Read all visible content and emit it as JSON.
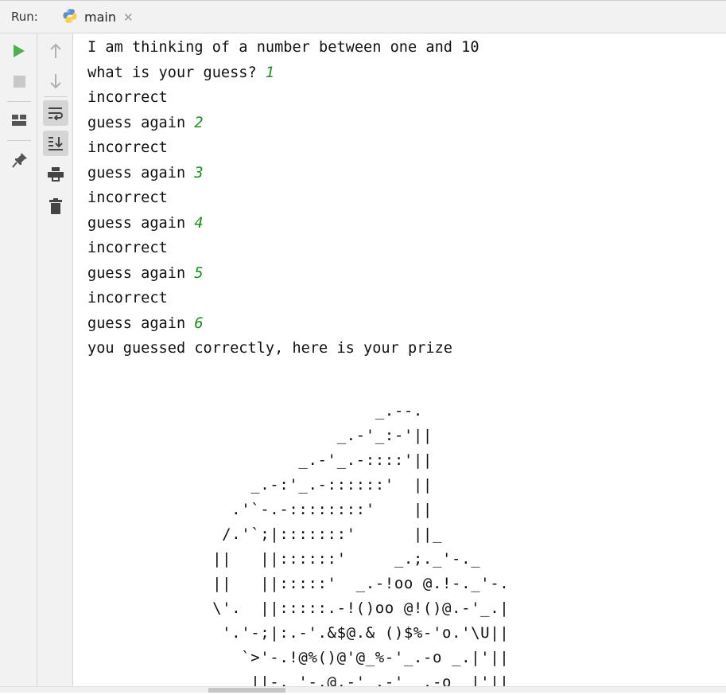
{
  "run_panel": {
    "label": "Run:",
    "tab": {
      "label": "main",
      "icon": "python-icon",
      "close_icon": "close-icon"
    }
  },
  "left_toolbar": [
    "rerun-icon",
    "stop-icon",
    "layout-icon",
    "pin-icon"
  ],
  "side_toolbar": [
    "up-arrow-icon",
    "down-arrow-icon",
    "soft-wrap-icon",
    "scroll-to-end-icon",
    "print-icon",
    "trash-icon"
  ],
  "colors": {
    "input_text": "#1f8a1f",
    "run_green": "#4caf50"
  },
  "console": {
    "lines": [
      {
        "text": "I am thinking of a number between one and 10",
        "input": ""
      },
      {
        "text": "what is your guess? ",
        "input": "1"
      },
      {
        "text": "incorrect",
        "input": ""
      },
      {
        "text": "guess again ",
        "input": "2"
      },
      {
        "text": "incorrect",
        "input": ""
      },
      {
        "text": "guess again ",
        "input": "3"
      },
      {
        "text": "incorrect",
        "input": ""
      },
      {
        "text": "guess again ",
        "input": "4"
      },
      {
        "text": "incorrect",
        "input": ""
      },
      {
        "text": "guess again ",
        "input": "5"
      },
      {
        "text": "incorrect",
        "input": ""
      },
      {
        "text": "guess again ",
        "input": "6"
      },
      {
        "text": "you guessed correctly, here is your prize",
        "input": ""
      }
    ],
    "ascii_art": [
      "                   _.--.",
      "               _.-'_:-'||",
      "           _.-'_.-::::'||",
      "      _.-:'_.-::::::'  ||",
      "    .'`-.-::::::::'    ||",
      "   /.'`;|:::::::'      ||_",
      "  ||   ||::::::'     _.;._'-._",
      "  ||   ||:::::'  _.-!oo @.!-._'-.",
      "  \\'.  ||:::::.-!()oo @!()@.-'_.|",
      "   '.'-;|:.-'.&$@.& ()$%-'o.'\\U||",
      "     `>'-.!@%()@'@_%-'_.-o _.|'||",
      "      ||-._'-.@.-'_.-' _.-o  |'||"
    ]
  }
}
